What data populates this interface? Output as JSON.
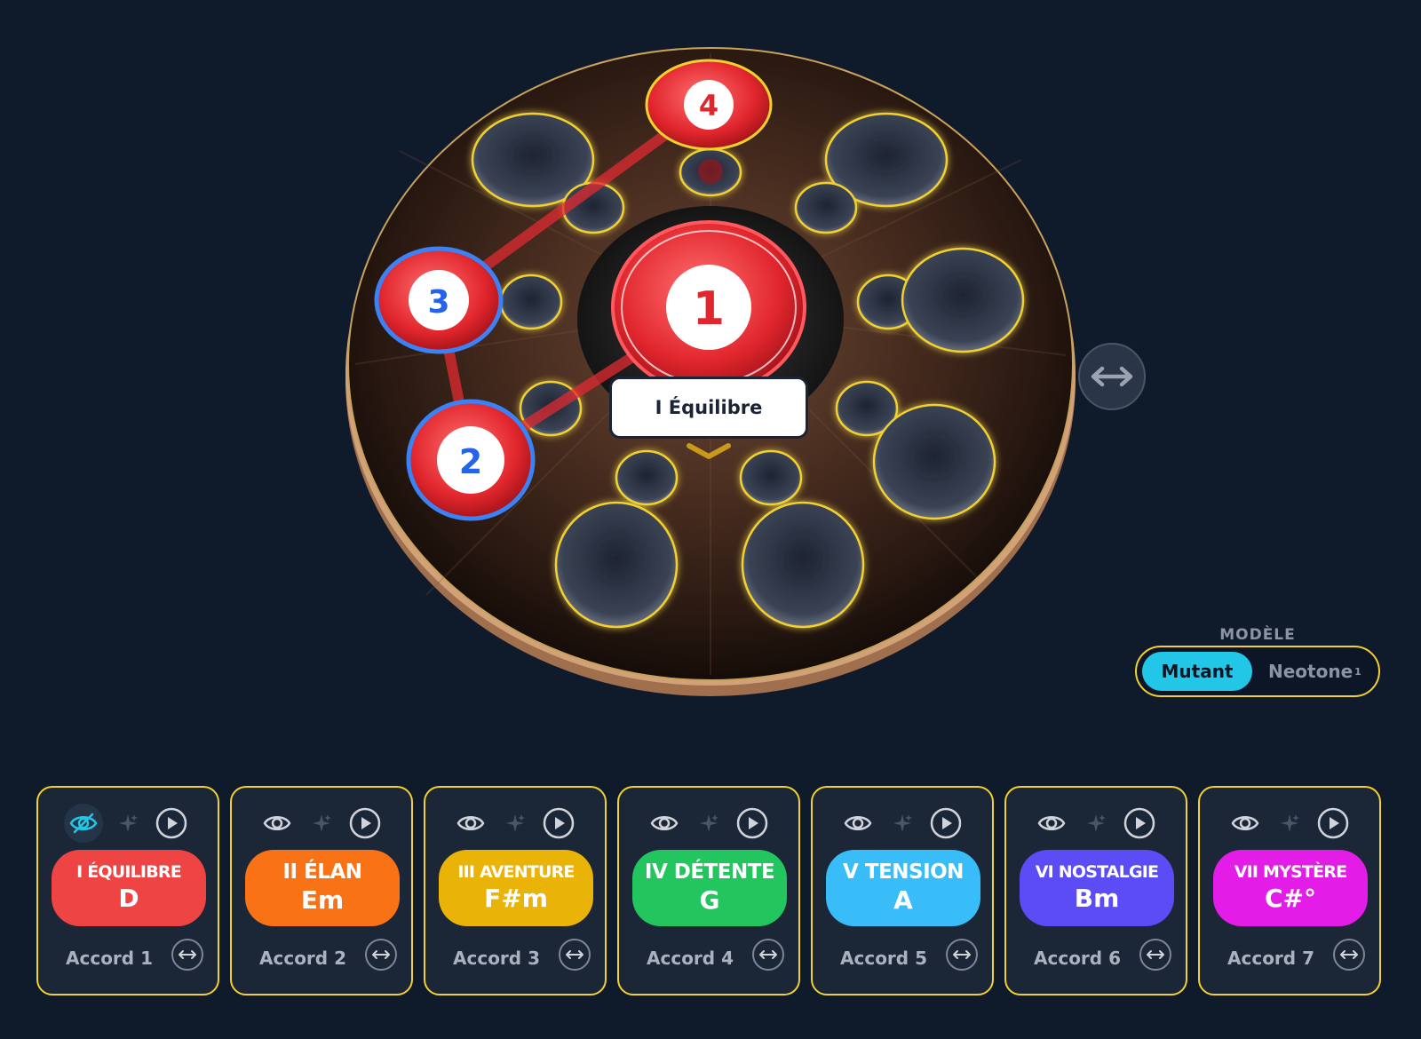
{
  "drum": {
    "selected_tooltip": "I Équilibre",
    "markers": [
      {
        "label": "1"
      },
      {
        "label": "2"
      },
      {
        "label": "3"
      },
      {
        "label": "4"
      }
    ]
  },
  "model": {
    "title": "MODÈLE",
    "options": [
      {
        "label": "Mutant",
        "active": true
      },
      {
        "label": "Neotone",
        "superscript": "1",
        "active": false
      }
    ]
  },
  "chords": [
    {
      "name": "I ÉQUILIBRE",
      "chord": "D",
      "label": "Accord 1",
      "color": "#ef4444",
      "eye_active": true
    },
    {
      "name": "II ÉLAN",
      "chord": "Em",
      "label": "Accord 2",
      "color": "#f97316",
      "eye_active": false
    },
    {
      "name": "III AVENTURE",
      "chord": "F#m",
      "label": "Accord 3",
      "color": "#eab308",
      "eye_active": false
    },
    {
      "name": "IV DÉTENTE",
      "chord": "G",
      "label": "Accord 4",
      "color": "#22c55e",
      "eye_active": false
    },
    {
      "name": "V TENSION",
      "chord": "A",
      "label": "Accord 5",
      "color": "#38bdf8",
      "eye_active": false
    },
    {
      "name": "VI NOSTALGIE",
      "chord": "Bm",
      "label": "Accord 6",
      "color": "#5b4cf5",
      "eye_active": false
    },
    {
      "name": "VII MYSTÈRE",
      "chord": "C#°",
      "label": "Accord 7",
      "color": "#e31ce8",
      "eye_active": false
    }
  ],
  "icons": {
    "eye": "eye-icon",
    "eye_off": "eye-off-icon",
    "sparkle": "sparkle-icon",
    "play": "play-icon",
    "swap": "swap-horizontal-icon"
  }
}
